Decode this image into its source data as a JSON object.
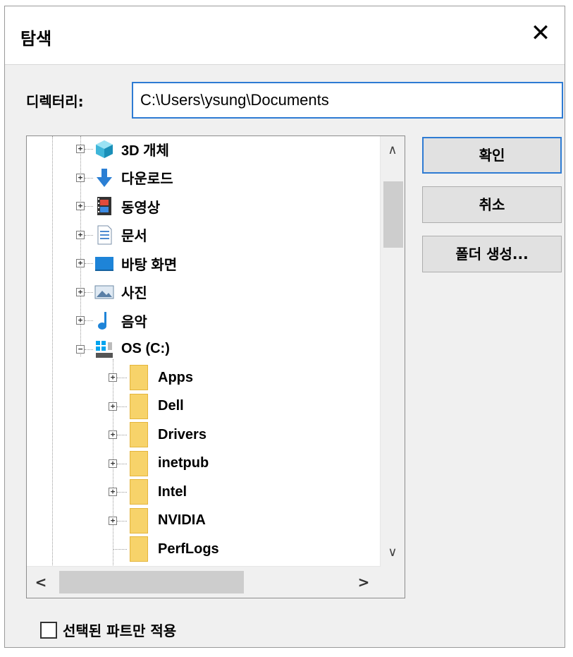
{
  "dialog": {
    "title": "탐색",
    "close_glyph": "✕",
    "directory_label": "디렉터리:",
    "directory_value": "C:\\Users\\ysung\\Documents",
    "buttons": {
      "ok": "확인",
      "cancel": "취소",
      "new_folder": "폴더 생성..."
    },
    "checkbox_label": "선택된 파트만 적용",
    "checkbox_checked": false
  },
  "tree": {
    "top_items": [
      {
        "label": "3D 개체",
        "icon": "3d-objects-icon",
        "expander": "+"
      },
      {
        "label": "다운로드",
        "icon": "downloads-icon",
        "expander": "+"
      },
      {
        "label": "동영상",
        "icon": "videos-icon",
        "expander": "+"
      },
      {
        "label": "문서",
        "icon": "documents-icon",
        "expander": "+"
      },
      {
        "label": "바탕 화면",
        "icon": "desktop-icon",
        "expander": "+"
      },
      {
        "label": "사진",
        "icon": "pictures-icon",
        "expander": "+"
      },
      {
        "label": "음악",
        "icon": "music-icon",
        "expander": "+"
      },
      {
        "label": "OS (C:)",
        "icon": "drive-icon",
        "expander": "−"
      }
    ],
    "drive_children": [
      {
        "label": "Apps",
        "expander": "+"
      },
      {
        "label": "Dell",
        "expander": "+"
      },
      {
        "label": "Drivers",
        "expander": "+"
      },
      {
        "label": "inetpub",
        "expander": "+"
      },
      {
        "label": "Intel",
        "expander": "+"
      },
      {
        "label": "NVIDIA",
        "expander": "+"
      },
      {
        "label": "PerfLogs",
        "expander": ""
      }
    ],
    "scroll_glyphs": {
      "up": "∧",
      "down": "∨",
      "left": "<",
      "right": ">"
    }
  }
}
